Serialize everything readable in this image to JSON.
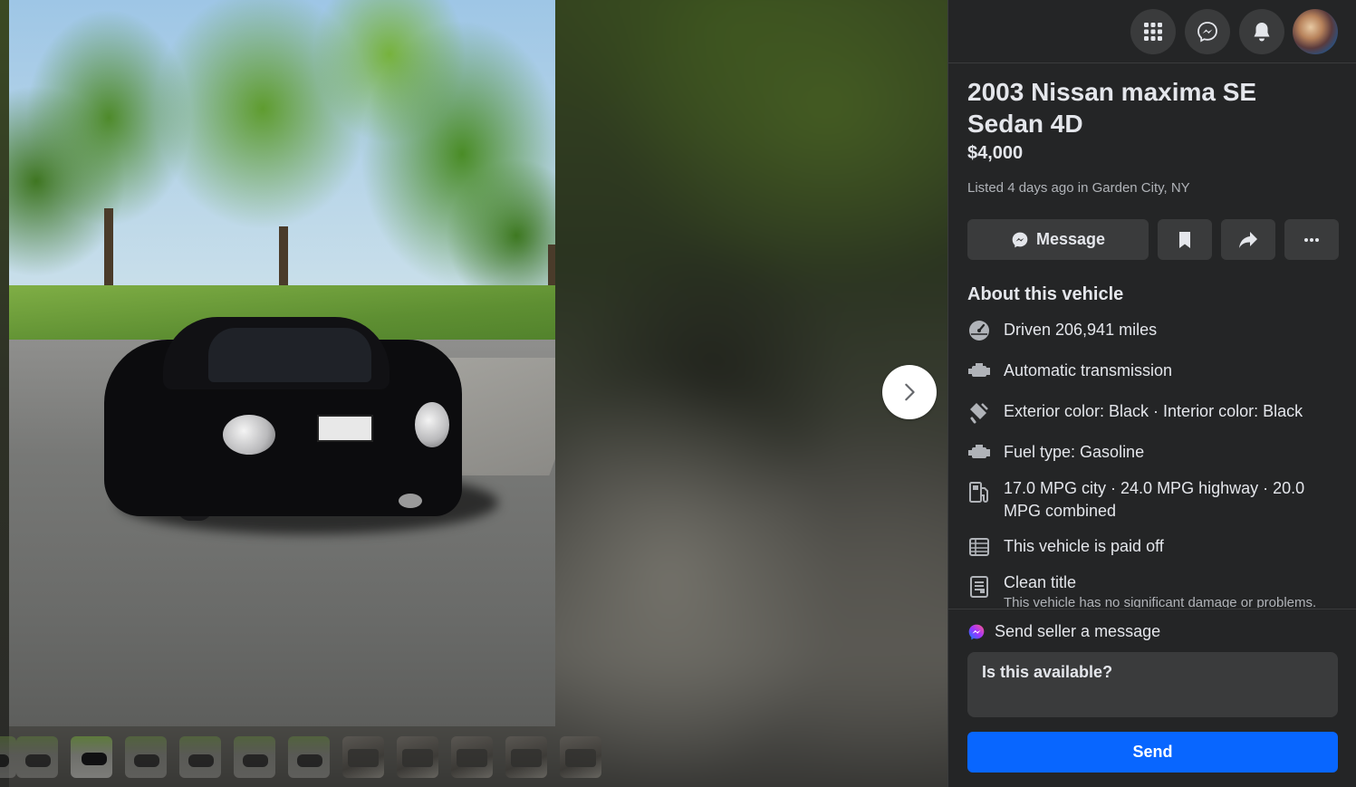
{
  "listing": {
    "title": "2003 Nissan maxima SE Sedan 4D",
    "price": "$4,000",
    "listed": "Listed 4 days ago in Garden City, NY"
  },
  "topbar": {
    "icons": [
      "menu-grid-icon",
      "messenger-icon",
      "notifications-bell-icon"
    ],
    "avatar": "profile-avatar"
  },
  "actions": {
    "message_label": "Message",
    "icons": [
      "messenger-icon",
      "bookmark-icon",
      "share-icon",
      "more-icon"
    ]
  },
  "about": {
    "heading": "About this vehicle",
    "specs": [
      {
        "icon": "speedometer-icon",
        "text": "Driven 206,941 miles"
      },
      {
        "icon": "engine-icon",
        "text": "Automatic transmission"
      },
      {
        "icon": "paint-icon",
        "text": "Exterior color: Black · Interior color: Black"
      },
      {
        "icon": "engine-icon",
        "text": "Fuel type: Gasoline"
      },
      {
        "icon": "fuel-pump-icon",
        "text": "17.0 MPG city · 24.0 MPG highway · 20.0 MPG combined"
      },
      {
        "icon": "bank-note-icon",
        "text": "This vehicle is paid off"
      },
      {
        "icon": "document-icon",
        "text": "Clean title",
        "subtext": "This vehicle has no significant damage or problems."
      }
    ]
  },
  "compose": {
    "heading": "Send seller a message",
    "message_value": "Is this available?",
    "send_label": "Send"
  },
  "gallery": {
    "thumbnail_count": 11,
    "active_index": 1,
    "thumbnail_kinds": [
      "exterior",
      "exterior",
      "exterior",
      "exterior",
      "exterior",
      "exterior",
      "interior",
      "interior",
      "interior",
      "interior",
      "interior"
    ]
  },
  "colors": {
    "panel_bg": "#242526",
    "button_bg": "#3a3b3c",
    "primary_text": "#e4e6eb",
    "secondary_text": "#b0b3b8",
    "accent_blue": "#0866ff"
  }
}
